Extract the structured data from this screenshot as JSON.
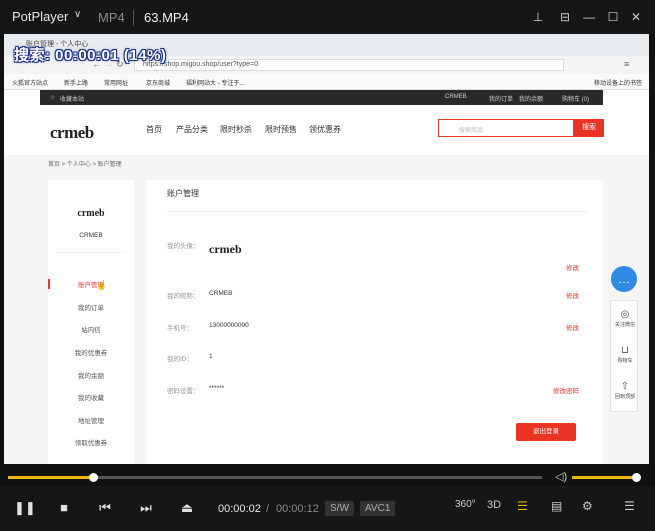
{
  "player": {
    "app_name": "PotPlayer",
    "format": "MP4",
    "file_name": "63.MP4",
    "overlay": "搜索: 00:00:01 (14%)",
    "current_time": "00:00:02",
    "total_time": "00:00:12",
    "time_separator": "/",
    "badge_sw": "S/W",
    "badge_codec": "AVC1",
    "label_360": "360°",
    "label_3d": "3D",
    "progress": 0.16,
    "volume": 1.0,
    "accent_color": "#e8b600"
  },
  "browser": {
    "tab_title": "账户管理 - 个人中心",
    "url": "https://shop.migou.shop/user?type=0",
    "bookmarks": [
      "火狐官方站点",
      "新手上路",
      "常用网址",
      "京东商城",
      "福利网站大 - 专注于..."
    ],
    "mobile_bookmarks": "移动设备上的书签"
  },
  "site": {
    "topbar_left": "收藏本站",
    "topbar_user": "CRMEB",
    "topbar_links": [
      "我的订单",
      "我的余额",
      "购物车 (0)"
    ],
    "logo": "crmeb",
    "nav": [
      "首页",
      "产品分类",
      "限时秒杀",
      "限时预售",
      "领优惠券"
    ],
    "search_placeholder": "搜索商品",
    "search_button": "搜索",
    "breadcrumb": "首页 > 个人中心 > 账户管理",
    "brand_color": "#e93323"
  },
  "sidebar": {
    "logo": "crmeb",
    "name": "CRMEB",
    "items": [
      "账户管理",
      "我的订单",
      "站内信",
      "我的优惠券",
      "我的余额",
      "我的收藏",
      "地址管理",
      "领取优惠券"
    ]
  },
  "account": {
    "title": "账户管理",
    "avatar_label": "我的头像：",
    "avatar_logo": "crmeb",
    "nickname_label": "我的昵称：",
    "nickname": "CRMEB",
    "phone_label": "手机号：",
    "phone": "13000000000",
    "id_label": "我的ID：",
    "id": "1",
    "password_label": "密码设置：",
    "password": "******",
    "edit": "修改",
    "edit_password": "修改密码",
    "logout": "退出登录"
  },
  "float_panel": {
    "items": [
      "关注微信",
      "购物车",
      "回到顶部"
    ]
  }
}
